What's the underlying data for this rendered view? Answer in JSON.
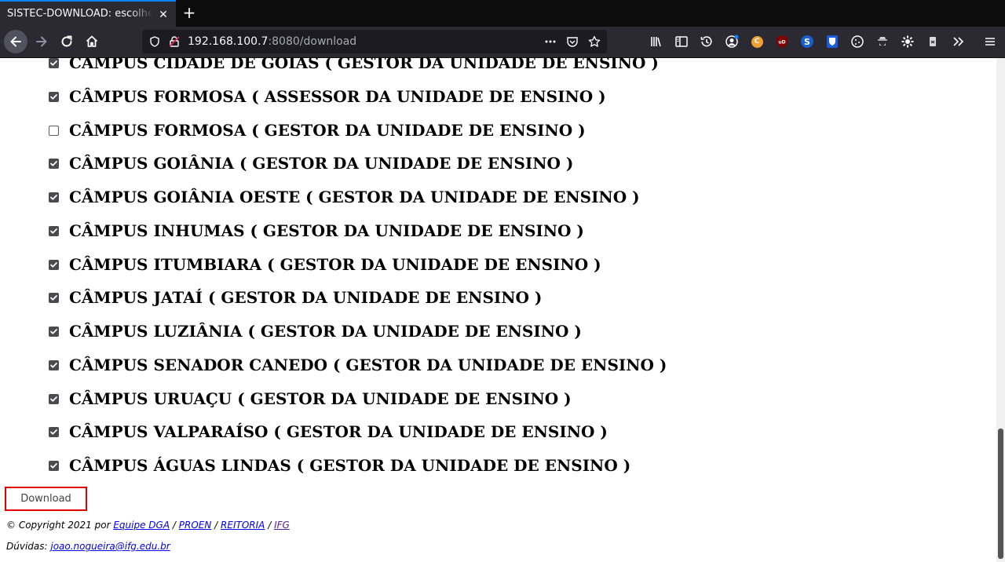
{
  "browser": {
    "tab_title": "SISTEC-DOWNLOAD: escolher",
    "url_host": "192.168.100.7",
    "url_rest": ":8080/download",
    "accent_color": "#0a84ff"
  },
  "campuses": [
    {
      "label": "CÂMPUS CIDADE DE GOIÁS ( GESTOR DA UNIDADE DE ENSINO )",
      "checked": true
    },
    {
      "label": "CÂMPUS FORMOSA ( ASSESSOR DA UNIDADE DE ENSINO )",
      "checked": true
    },
    {
      "label": "CÂMPUS FORMOSA ( GESTOR DA UNIDADE DE ENSINO )",
      "checked": false
    },
    {
      "label": "CÂMPUS GOIÂNIA ( GESTOR DA UNIDADE DE ENSINO )",
      "checked": true
    },
    {
      "label": "CÂMPUS GOIÂNIA OESTE ( GESTOR DA UNIDADE DE ENSINO )",
      "checked": true
    },
    {
      "label": "CÂMPUS INHUMAS ( GESTOR DA UNIDADE DE ENSINO )",
      "checked": true
    },
    {
      "label": "CÂMPUS ITUMBIARA ( GESTOR DA UNIDADE DE ENSINO )",
      "checked": true
    },
    {
      "label": "CÂMPUS JATAÍ ( GESTOR DA UNIDADE DE ENSINO )",
      "checked": true
    },
    {
      "label": "CÂMPUS LUZIÂNIA ( GESTOR DA UNIDADE DE ENSINO )",
      "checked": true
    },
    {
      "label": "CÂMPUS SENADOR CANEDO ( GESTOR DA UNIDADE DE ENSINO )",
      "checked": true
    },
    {
      "label": "CÂMPUS URUAÇU ( GESTOR DA UNIDADE DE ENSINO )",
      "checked": true
    },
    {
      "label": "CÂMPUS VALPARAÍSO ( GESTOR DA UNIDADE DE ENSINO )",
      "checked": true
    },
    {
      "label": "CÂMPUS ÁGUAS LINDAS ( GESTOR DA UNIDADE DE ENSINO )",
      "checked": true
    }
  ],
  "download_label": "Download",
  "download_border_color": "#e00000",
  "footer": {
    "copyright_prefix": "© Copyright 2021 por",
    "link_dga": "Equipe DGA",
    "sep1": "/",
    "link_proen": "PROEN",
    "sep2": "/",
    "link_reitoria": "REITORIA",
    "sep3": "/",
    "link_ifg": "IFG",
    "duvidas_prefix": "Dúvidas:",
    "email": "joao.nogueira@ifg.edu.br"
  }
}
